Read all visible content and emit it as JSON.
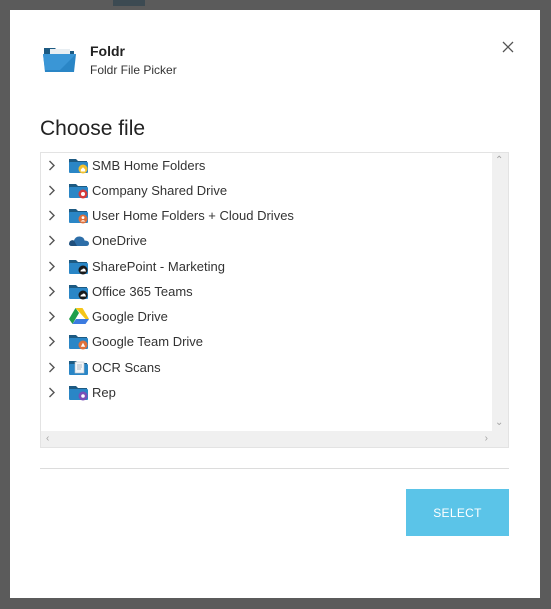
{
  "app": {
    "name": "Foldr",
    "subtitle": "Foldr File Picker"
  },
  "dialog": {
    "title": "Choose file",
    "select_label": "SELECT"
  },
  "tree": {
    "items": [
      {
        "label": "SMB Home Folders",
        "icon": "smb-home-folder-icon"
      },
      {
        "label": "Company Shared Drive",
        "icon": "shared-drive-folder-icon"
      },
      {
        "label": "User Home Folders + Cloud Drives",
        "icon": "user-home-folder-icon"
      },
      {
        "label": "OneDrive",
        "icon": "onedrive-cloud-icon"
      },
      {
        "label": "SharePoint - Marketing",
        "icon": "sharepoint-folder-icon"
      },
      {
        "label": "Office 365 Teams",
        "icon": "office365-teams-folder-icon"
      },
      {
        "label": "Google Drive",
        "icon": "google-drive-icon"
      },
      {
        "label": "Google Team Drive",
        "icon": "google-team-drive-folder-icon"
      },
      {
        "label": "OCR Scans",
        "icon": "ocr-scans-folder-icon"
      },
      {
        "label": "Rep",
        "icon": "rep-folder-icon"
      }
    ]
  },
  "colors": {
    "accent": "#5bc4e8",
    "folder_blue": "#2a86c6"
  }
}
